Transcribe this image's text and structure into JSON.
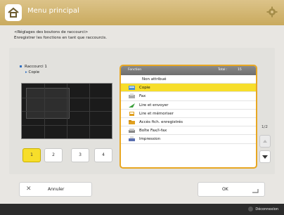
{
  "title": "Menu principal",
  "instruction": [
    "<Réglages des boutons de raccourci>",
    "Enregistrer les fonctions en tant que raccourcis."
  ],
  "shortcut": {
    "label": "Raccourci 1",
    "sub": "Copie"
  },
  "pages": [
    "1",
    "2",
    "3",
    "4"
  ],
  "active_page": "1",
  "list_header": {
    "function": "Fonction",
    "total": "Total :",
    "count": "15"
  },
  "functions": [
    {
      "label": "Non attribué",
      "icon": "none"
    },
    {
      "label": "Copie",
      "icon": "copy-icon",
      "selected": true
    },
    {
      "label": "Fax",
      "icon": "fax-icon"
    },
    {
      "label": "Lire et envoyer",
      "icon": "scan-send-icon"
    },
    {
      "label": "Lire et mémoriser",
      "icon": "scan-store-icon"
    },
    {
      "label": "Accès fich. enregistrés",
      "icon": "stored-files-icon"
    },
    {
      "label": "Boîte Fax/I-fax",
      "icon": "fax-inbox-icon"
    },
    {
      "label": "Impression",
      "icon": "print-icon"
    }
  ],
  "page_counter": "1/2",
  "cancel_label": "Annuler",
  "ok_label": "OK",
  "logout_label": "Déconnexion",
  "colors": {
    "accent": "#f7de2a",
    "header": "#c9aa5e",
    "list_border": "#e8a722"
  }
}
